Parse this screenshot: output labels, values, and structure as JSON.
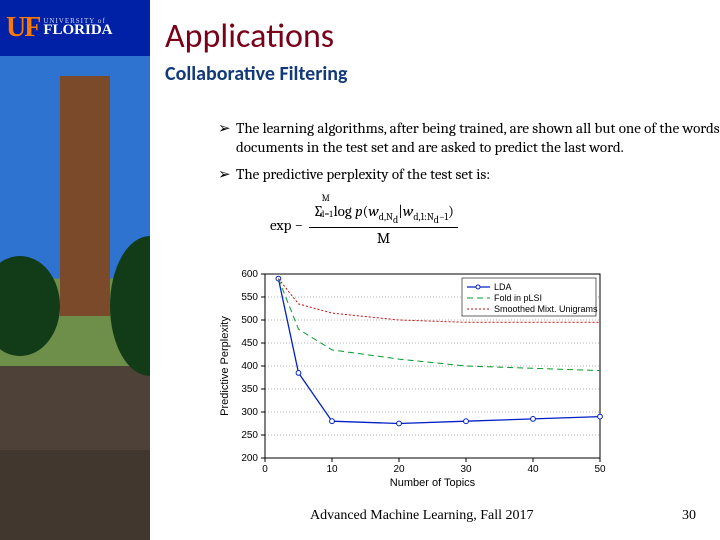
{
  "logo": {
    "mark": "UF",
    "top": "UNIVERSITY of",
    "bottom": "FLORIDA"
  },
  "title": "Applications",
  "subtitle": "Collaborative Filtering",
  "bullets": [
    "The learning algorithms, after being trained, are shown all but one of the words of documents in the test set and are asked to predict the last word.",
    "The predictive perplexity of the test set is:"
  ],
  "formula": {
    "prefix": "exp −",
    "numerator": "∑ᴹ₍d=1₎ log p(w_d,N_d | w_d,1:N_d−1)",
    "denominator": "M"
  },
  "footer": "Advanced Machine Learning, Fall 2017",
  "page": "30",
  "chart_data": {
    "type": "line",
    "title": "",
    "xlabel": "Number of Topics",
    "ylabel": "Predictive Perplexity",
    "xlim": [
      0,
      50
    ],
    "ylim": [
      200,
      600
    ],
    "xticks": [
      0,
      10,
      20,
      30,
      40,
      50
    ],
    "yticks": [
      200,
      250,
      300,
      350,
      400,
      450,
      500,
      550,
      600
    ],
    "legend": {
      "position": "top-right",
      "entries": [
        "LDA",
        "Fold in pLSI",
        "Smoothed Mixt. Unigrams"
      ]
    },
    "series": [
      {
        "name": "LDA",
        "style": "solid-blue-markers",
        "x": [
          2,
          5,
          10,
          20,
          30,
          40,
          50
        ],
        "y": [
          590,
          385,
          280,
          275,
          280,
          285,
          290
        ]
      },
      {
        "name": "Fold in pLSI",
        "style": "dashed-green",
        "x": [
          2,
          5,
          10,
          20,
          30,
          40,
          50
        ],
        "y": [
          590,
          480,
          435,
          415,
          400,
          395,
          390
        ]
      },
      {
        "name": "Smoothed Mixt. Unigrams",
        "style": "dotted-red",
        "x": [
          2,
          5,
          10,
          20,
          30,
          40,
          50
        ],
        "y": [
          590,
          535,
          515,
          500,
          495,
          495,
          495
        ]
      }
    ]
  }
}
